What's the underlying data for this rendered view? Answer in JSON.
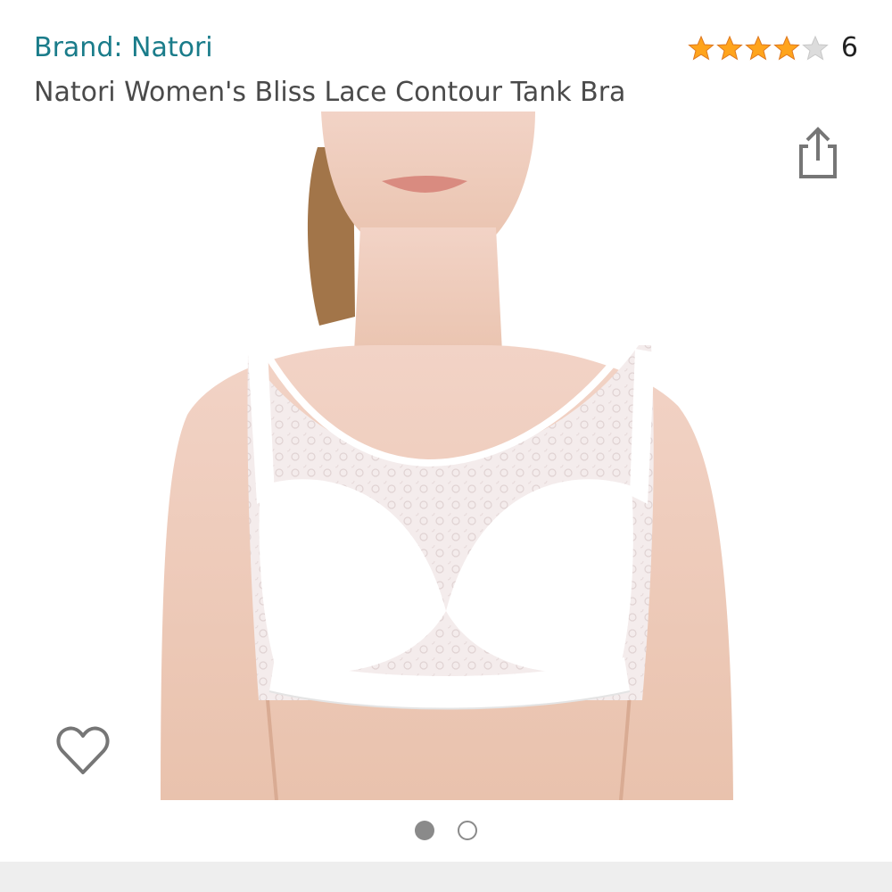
{
  "product": {
    "brand": "Brand: Natori",
    "title": "Natori Women's Bliss Lace Contour Tank Bra",
    "rating_value": 4.0,
    "rating_max": 5,
    "rating_count": "6",
    "star_color": "#ffa41c",
    "star_empty_color": "#dcdcdc"
  },
  "gallery": {
    "image_count": 2,
    "current_index": 1
  },
  "icons": {
    "share": "share-icon",
    "wishlist": "heart-outline-icon"
  },
  "colors": {
    "brand_link": "#1a7c8a",
    "title_text": "#4a4a4a",
    "icon_gray": "#767676"
  }
}
